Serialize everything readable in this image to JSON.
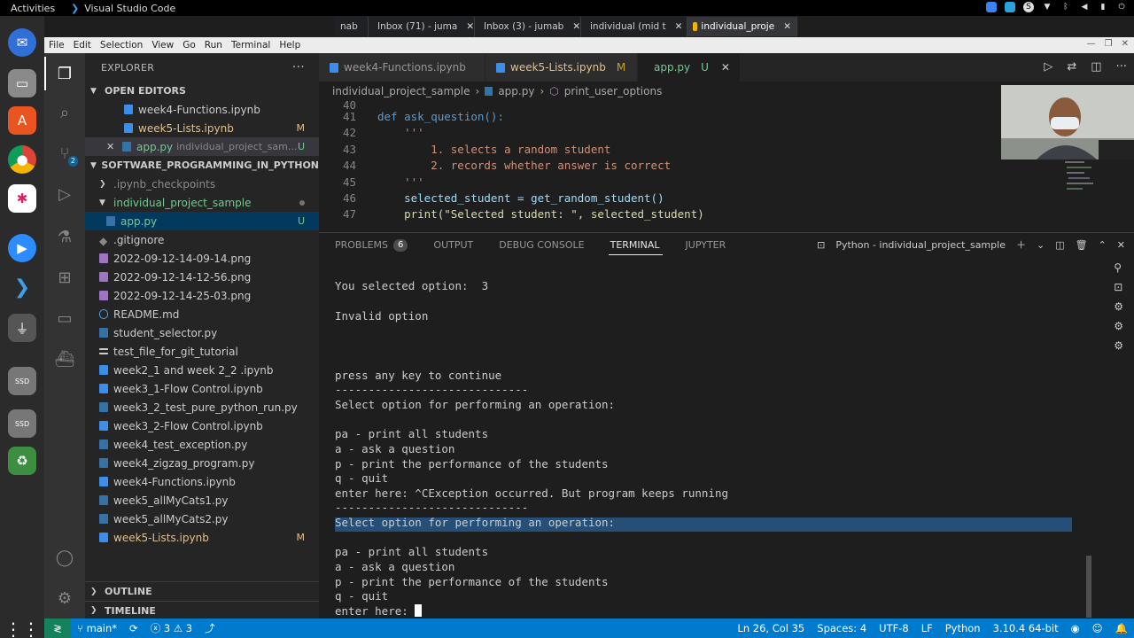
{
  "system": {
    "activities": "Activities",
    "app_title": "Visual Studio Code"
  },
  "browser_tabs": [
    {
      "label": "nab",
      "active": false
    },
    {
      "label": "Inbox (71) - juma",
      "active": false
    },
    {
      "label": "Inbox (3) - jumab",
      "active": false
    },
    {
      "label": "individual (mid t",
      "active": false
    },
    {
      "label": "individual_proje",
      "active": true
    }
  ],
  "menu": [
    "File",
    "Edit",
    "Selection",
    "View",
    "Go",
    "Run",
    "Terminal",
    "Help"
  ],
  "activity_badges": {
    "source_control": "2"
  },
  "explorer": {
    "title": "EXPLORER",
    "open_editors_label": "OPEN EDITORS",
    "open_editors": [
      {
        "name": "week4-Functions.ipynb",
        "mod": ""
      },
      {
        "name": "week5-Lists.ipynb",
        "mod": "M"
      },
      {
        "name": "app.py",
        "sub": "individual_project_sam...",
        "mod": "U"
      }
    ],
    "folder_label": "SOFTWARE_PROGRAMMING_IN_PYTHON",
    "tree": [
      {
        "name": ".ipynb_checkpoints",
        "mod": ""
      },
      {
        "name": "individual_project_sample",
        "mod": ""
      },
      {
        "name": "app.py",
        "mod": "U"
      },
      {
        "name": ".gitignore",
        "mod": ""
      },
      {
        "name": "2022-09-12-14-09-14.png",
        "mod": ""
      },
      {
        "name": "2022-09-12-14-12-56.png",
        "mod": ""
      },
      {
        "name": "2022-09-12-14-25-03.png",
        "mod": ""
      },
      {
        "name": "README.md",
        "mod": ""
      },
      {
        "name": "student_selector.py",
        "mod": ""
      },
      {
        "name": "test_file_for_git_tutorial",
        "mod": ""
      },
      {
        "name": "week2_1 and week 2_2 .ipynb",
        "mod": ""
      },
      {
        "name": "week3_1-Flow Control.ipynb",
        "mod": ""
      },
      {
        "name": "week3_2_test_pure_python_run.py",
        "mod": ""
      },
      {
        "name": "week3_2-Flow Control.ipynb",
        "mod": ""
      },
      {
        "name": "week4_test_exception.py",
        "mod": ""
      },
      {
        "name": "week4_zigzag_program.py",
        "mod": ""
      },
      {
        "name": "week4-Functions.ipynb",
        "mod": ""
      },
      {
        "name": "week5_allMyCats1.py",
        "mod": ""
      },
      {
        "name": "week5_allMyCats2.py",
        "mod": ""
      },
      {
        "name": "week5-Lists.ipynb",
        "mod": "M"
      }
    ],
    "outline_label": "OUTLINE",
    "timeline_label": "TIMELINE"
  },
  "editor_tabs": [
    {
      "name": "week4-Functions.ipynb",
      "mod": ""
    },
    {
      "name": "week5-Lists.ipynb",
      "mod": "M"
    },
    {
      "name": "app.py",
      "mod": "U"
    }
  ],
  "breadcrumbs": [
    "individual_project_sample",
    "app.py",
    "print_user_options"
  ],
  "code": {
    "lines": [
      {
        "n": "41",
        "t": "def ask_question():"
      },
      {
        "n": "42",
        "t": "    '''"
      },
      {
        "n": "43",
        "t": "        1. selects a random student"
      },
      {
        "n": "44",
        "t": "        2. records whether answer is correct"
      },
      {
        "n": "45",
        "t": "    '''"
      },
      {
        "n": "46",
        "t": "    selected_student = get_random_student()"
      },
      {
        "n": "47",
        "t": "    print(\"Selected student: \", selected_student)"
      }
    ]
  },
  "panel": {
    "tabs": [
      "PROBLEMS",
      "OUTPUT",
      "DEBUG CONSOLE",
      "TERMINAL",
      "JUPYTER"
    ],
    "problems_count": "6",
    "terminal_name": "Python - individual_project_sample"
  },
  "terminal_lines": [
    "You selected option:  3",
    "",
    "Invalid option",
    "",
    "",
    "",
    "press any key to continue",
    "-----------------------------",
    "Select option for performing an operation:",
    "",
    "pa - print all students",
    "a - ask a question",
    "p - print the performance of the students",
    "q - quit",
    "enter here: ^CException occurred. But program keeps running",
    "-----------------------------",
    "Select option for performing an operation:",
    "",
    "pa - print all students",
    "a - ask a question",
    "p - print the performance of the students",
    "q - quit",
    "enter here: "
  ],
  "status": {
    "branch": "main*",
    "errors": "3",
    "warnings": "3",
    "position": "Ln 26, Col 35",
    "spaces": "Spaces: 4",
    "encoding": "UTF-8",
    "eol": "LF",
    "language": "Python",
    "interpreter": "3.10.4 64-bit"
  }
}
